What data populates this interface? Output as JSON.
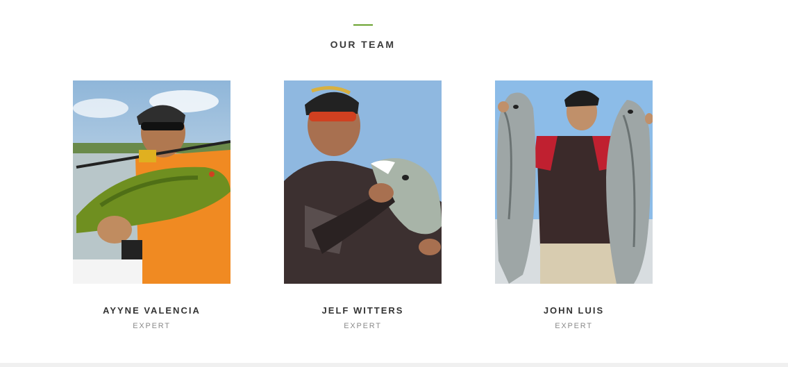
{
  "section": {
    "title": "OUR TEAM",
    "accent_color": "#6aa22f"
  },
  "team": [
    {
      "name": "AYYNE VALENCIA",
      "role": "EXPERT",
      "photo_icon": "angler-holding-peacock-bass"
    },
    {
      "name": "JELF WITTERS",
      "role": "EXPERT",
      "photo_icon": "angler-holding-bass"
    },
    {
      "name": "JOHN LUIS",
      "role": "EXPERT",
      "photo_icon": "angler-holding-two-sea-bass"
    }
  ]
}
